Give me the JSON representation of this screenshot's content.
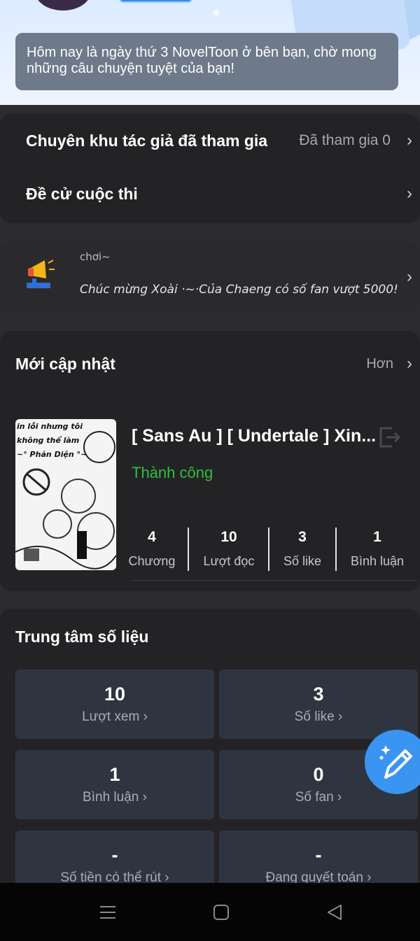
{
  "greeting": "Hôm nay là ngày thứ 3 NovelToon ở bên bạn, chờ mong những câu chuyện tuyệt của bạn!",
  "menu": {
    "items": [
      {
        "title": "Chuyên khu tác giả đã tham gia",
        "value": "Đã tham gia 0"
      },
      {
        "title": "Đề cử cuộc thi",
        "value": ""
      }
    ]
  },
  "notice": {
    "partial_line": "chơi~",
    "text": "Chúc mừng Xoài ·~·Của Chaeng  có số fan vượt 5000!"
  },
  "recent": {
    "title": "Mới cập nhật",
    "more": "Hơn",
    "book": {
      "title": "[ Sans Au ] [ Undertale ] Xin...",
      "status": "Thành công",
      "cover_lines": [
        "in lỗi nhưng tôi",
        "không thể làm",
        "~° Phản Diện °~"
      ],
      "stats": [
        {
          "value": "4",
          "label": "Chương"
        },
        {
          "value": "10",
          "label": "Lượt đọc"
        },
        {
          "value": "3",
          "label": "Số like"
        },
        {
          "value": "1",
          "label": "Bình luận"
        }
      ]
    }
  },
  "data_center": {
    "title": "Trung tâm số liệu",
    "tiles": [
      {
        "value": "10",
        "label": "Lượt xem ›"
      },
      {
        "value": "3",
        "label": "Số like ›"
      },
      {
        "value": "1",
        "label": "Bình luận ›"
      },
      {
        "value": "0",
        "label": "Số fan ›"
      },
      {
        "value": "-",
        "label": "Số tiền có thể rút ›"
      },
      {
        "value": "-",
        "label": "Đang quyết toán ›"
      }
    ]
  },
  "colors": {
    "success": "#2fbf3d",
    "fab": "#3a94f1",
    "card": "#232325"
  },
  "icons": [
    "megaphone-icon",
    "chevron-right-icon",
    "exit-icon",
    "pencil-icon",
    "menu-icon",
    "home-icon",
    "back-icon"
  ]
}
